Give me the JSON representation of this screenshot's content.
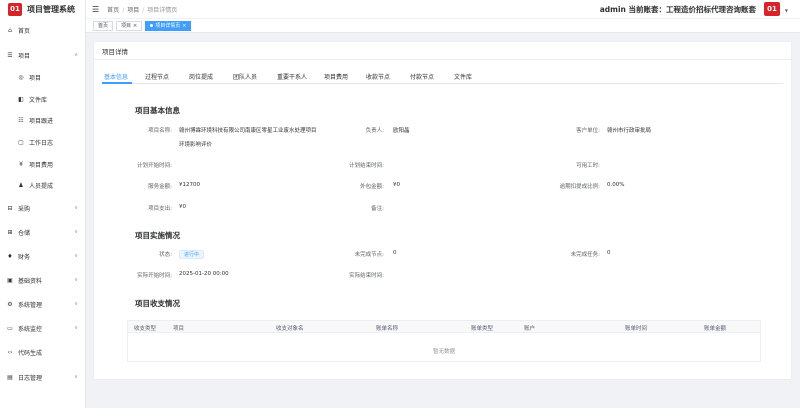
{
  "app": {
    "logo": "01",
    "title": "项目管理系统"
  },
  "sidebar": {
    "items": [
      {
        "label": "首页",
        "icon": "home-icon",
        "glyph": "⌂",
        "expandable": false
      },
      {
        "label": "项目",
        "icon": "project-icon",
        "glyph": "☰",
        "expandable": true
      },
      {
        "label": "项目",
        "icon": "project-sub-icon",
        "glyph": "◎",
        "expandable": false,
        "sub": true
      },
      {
        "label": "文件库",
        "icon": "file-library-icon",
        "glyph": "◧",
        "expandable": false,
        "sub": true
      },
      {
        "label": "项目跟进",
        "icon": "follow-up-icon",
        "glyph": "☷",
        "expandable": false,
        "sub": true
      },
      {
        "label": "工作日志",
        "icon": "work-log-icon",
        "glyph": "▢",
        "expandable": false,
        "sub": true
      },
      {
        "label": "项目费用",
        "icon": "project-cost-icon",
        "glyph": "¥",
        "expandable": false,
        "sub": true
      },
      {
        "label": "人员提成",
        "icon": "commission-icon",
        "glyph": "♟",
        "expandable": false,
        "sub": true
      },
      {
        "label": "采购",
        "icon": "purchase-icon",
        "glyph": "⊟",
        "expandable": true
      },
      {
        "label": "仓储",
        "icon": "warehouse-icon",
        "glyph": "⊞",
        "expandable": true
      },
      {
        "label": "财务",
        "icon": "finance-icon",
        "glyph": "♦",
        "expandable": true
      },
      {
        "label": "基础资料",
        "icon": "base-data-icon",
        "glyph": "▣",
        "expandable": true
      },
      {
        "label": "系统管理",
        "icon": "system-admin-icon",
        "glyph": "⚙",
        "expandable": true
      },
      {
        "label": "系统监控",
        "icon": "system-monitor-icon",
        "glyph": "▭",
        "expandable": true
      },
      {
        "label": "代码生成",
        "icon": "code-gen-icon",
        "glyph": "‹›",
        "expandable": false
      },
      {
        "label": "日志管理",
        "icon": "log-admin-icon",
        "glyph": "▤",
        "expandable": true
      }
    ]
  },
  "header": {
    "breadcrumb": [
      "首页",
      "项目",
      "项目详情页"
    ],
    "account": "admin   当前账套：工程造价招标代理咨询账套",
    "avatar": "01"
  },
  "tags": [
    {
      "label": "首页",
      "active": false,
      "closable": false
    },
    {
      "label": "项目",
      "active": false,
      "closable": true
    },
    {
      "label": "项目详情页",
      "active": true,
      "closable": true
    }
  ],
  "card": {
    "title": "项目详情"
  },
  "tabs": [
    "基本信息",
    "过程节点",
    "岗位提成",
    "团队人员",
    "重要干系人",
    "项目费用",
    "收款节点",
    "付款节点",
    "文件库"
  ],
  "basic": {
    "heading": "项目基本信息",
    "name_label": "项目名称:",
    "name_value_1": "赣州博霖环境科技有限公司南康区零星工业废水处理项目",
    "name_value_2": "环境影响评价",
    "owner_label": "负责人:",
    "owner_value": "欧阳晶",
    "client_label": "客户单位:",
    "client_value": "赣州市行政审批局",
    "plan_start_label": "计划开始时间:",
    "plan_start_value": "",
    "plan_end_label": "计划结束时间:",
    "plan_end_value": "",
    "hours_label": "可用工时:",
    "hours_value": "",
    "service_label": "服务金额:",
    "service_value": "¥12700",
    "outsource_label": "外包金额:",
    "outsource_value": "¥0",
    "overdue_label": "逾期扣提成比例:",
    "overdue_value": "0.00%",
    "expense_label": "项目支出:",
    "expense_value": "¥0",
    "remark_label": "备注:",
    "remark_value": ""
  },
  "impl": {
    "heading": "项目实施情况",
    "status_label": "状态:",
    "status_value": "进行中",
    "nodes_label": "未完成节点:",
    "nodes_value": "0",
    "tasks_label": "未完成任务:",
    "tasks_value": "0",
    "actual_start_label": "实际开始时间:",
    "actual_start_value": "2025-01-20 00:00",
    "actual_end_label": "实际结束时间:",
    "actual_end_value": ""
  },
  "finance": {
    "heading": "项目收支情况",
    "columns": [
      "收支类型",
      "项目",
      "收支对象名",
      "账单名称",
      "账单类型",
      "账户",
      "账单时间",
      "账单金额"
    ],
    "empty": "暂无数据"
  },
  "colors": {
    "primary": "#409eff",
    "brand": "#d8232a"
  }
}
